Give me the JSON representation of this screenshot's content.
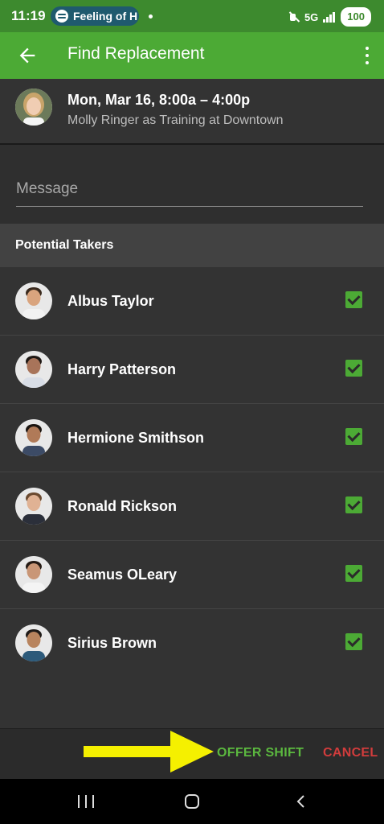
{
  "status_bar": {
    "time": "11:19",
    "now_playing": "Feeling of H",
    "network": "5G",
    "battery": "100"
  },
  "appbar": {
    "title": "Find Replacement",
    "back_icon": "arrow-left-icon",
    "menu_icon": "more-vertical-icon"
  },
  "shift": {
    "date_time": "Mon, Mar 16, 8:00a – 4:00p",
    "detail": "Molly Ringer as Training at Downtown"
  },
  "message": {
    "placeholder": "Message",
    "value": ""
  },
  "section": {
    "title": "Potential Takers"
  },
  "takers": [
    {
      "name": "Albus Taylor",
      "checked": true,
      "skin": "#d9a47e",
      "hair": "#3a2a1e",
      "shirt": "#f2f2f2"
    },
    {
      "name": "Harry Patterson",
      "checked": true,
      "skin": "#a8745a",
      "hair": "#1e1814",
      "shirt": "#d8dde6"
    },
    {
      "name": "Hermione Smithson",
      "checked": true,
      "skin": "#b07a58",
      "hair": "#1a1410",
      "shirt": "#3c4b66"
    },
    {
      "name": "Ronald Rickson",
      "checked": true,
      "skin": "#e0b294",
      "hair": "#6b4a30",
      "shirt": "#2b2f3a"
    },
    {
      "name": "Seamus OLeary",
      "checked": true,
      "skin": "#c99676",
      "hair": "#241a14",
      "shirt": "#f4f4f4"
    },
    {
      "name": "Sirius Brown",
      "checked": true,
      "skin": "#b8845e",
      "hair": "#1e1a18",
      "shirt": "#2d5a7a"
    }
  ],
  "footer": {
    "offer_label": "OFFER SHIFT",
    "cancel_label": "CANCEL"
  },
  "colors": {
    "status_bar": "#3d8a2e",
    "appbar": "#4caa35",
    "accent_green": "#5bb83f",
    "cancel_red": "#d13c3c",
    "annotation_arrow": "#f5f000"
  }
}
